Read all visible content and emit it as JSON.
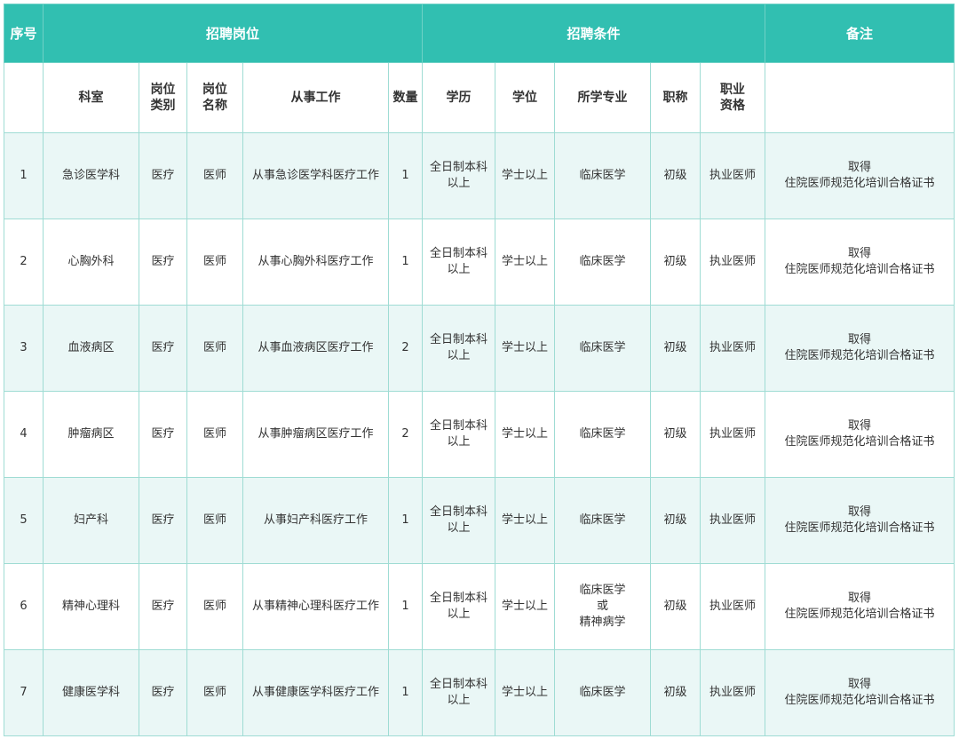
{
  "header": {
    "no": "序号",
    "position": "招聘岗位",
    "conditions": "招聘条件",
    "remark": "备注"
  },
  "subheader": {
    "dept": "科室",
    "type": [
      "岗位",
      "类别"
    ],
    "name": [
      "岗位",
      "名称"
    ],
    "work": "从事工作",
    "count": "数量",
    "education": "学历",
    "degree": "学位",
    "major": "所学专业",
    "title": "职称",
    "qualification": [
      "职业",
      "资格"
    ]
  },
  "rows": [
    {
      "no": "1",
      "dept": "急诊医学科",
      "type": "医疗",
      "name": "医师",
      "work": "从事急诊医学科医疗工作",
      "count": "1",
      "education": [
        "全日制本科",
        "以上"
      ],
      "degree": "学士以上",
      "major": [
        "临床医学"
      ],
      "title": "初级",
      "qualification": "执业医师",
      "remark": [
        "取得",
        "住院医师规范化培训合格证书"
      ]
    },
    {
      "no": "2",
      "dept": "心胸外科",
      "type": "医疗",
      "name": "医师",
      "work": "从事心胸外科医疗工作",
      "count": "1",
      "education": [
        "全日制本科",
        "以上"
      ],
      "degree": "学士以上",
      "major": [
        "临床医学"
      ],
      "title": "初级",
      "qualification": "执业医师",
      "remark": [
        "取得",
        "住院医师规范化培训合格证书"
      ]
    },
    {
      "no": "3",
      "dept": "血液病区",
      "type": "医疗",
      "name": "医师",
      "work": "从事血液病区医疗工作",
      "count": "2",
      "education": [
        "全日制本科",
        "以上"
      ],
      "degree": "学士以上",
      "major": [
        "临床医学"
      ],
      "title": "初级",
      "qualification": "执业医师",
      "remark": [
        "取得",
        "住院医师规范化培训合格证书"
      ]
    },
    {
      "no": "4",
      "dept": "肿瘤病区",
      "type": "医疗",
      "name": "医师",
      "work": "从事肿瘤病区医疗工作",
      "count": "2",
      "education": [
        "全日制本科",
        "以上"
      ],
      "degree": "学士以上",
      "major": [
        "临床医学"
      ],
      "title": "初级",
      "qualification": "执业医师",
      "remark": [
        "取得",
        "住院医师规范化培训合格证书"
      ]
    },
    {
      "no": "5",
      "dept": "妇产科",
      "type": "医疗",
      "name": "医师",
      "work": "从事妇产科医疗工作",
      "count": "1",
      "education": [
        "全日制本科",
        "以上"
      ],
      "degree": "学士以上",
      "major": [
        "临床医学"
      ],
      "title": "初级",
      "qualification": "执业医师",
      "remark": [
        "取得",
        "住院医师规范化培训合格证书"
      ]
    },
    {
      "no": "6",
      "dept": "精神心理科",
      "type": "医疗",
      "name": "医师",
      "work": "从事精神心理科医疗工作",
      "count": "1",
      "education": [
        "全日制本科",
        "以上"
      ],
      "degree": "学士以上",
      "major": [
        "临床医学",
        "或",
        "精神病学"
      ],
      "title": "初级",
      "qualification": "执业医师",
      "remark": [
        "取得",
        "住院医师规范化培训合格证书"
      ]
    },
    {
      "no": "7",
      "dept": "健康医学科",
      "type": "医疗",
      "name": "医师",
      "work": "从事健康医学科医疗工作",
      "count": "1",
      "education": [
        "全日制本科",
        "以上"
      ],
      "degree": "学士以上",
      "major": [
        "临床医学"
      ],
      "title": "初级",
      "qualification": "执业医师",
      "remark": [
        "取得",
        "住院医师规范化培训合格证书"
      ]
    }
  ],
  "colors": {
    "header_bg": "#31bfb1",
    "header_text": "#ffffff",
    "stripe": "#eaf7f6",
    "border": "#9fdcd4"
  }
}
